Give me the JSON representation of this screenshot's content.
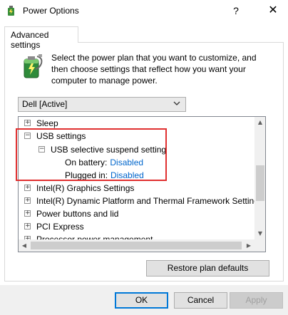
{
  "window": {
    "title": "Power Options",
    "help_glyph": "?",
    "close_glyph": "✕"
  },
  "tab": {
    "label": "Advanced settings"
  },
  "description": "Select the power plan that you want to customize, and then choose settings that reflect how you want your computer to manage power.",
  "plan_select": {
    "value": "Dell [Active]"
  },
  "tree": {
    "items": [
      {
        "label": "Sleep",
        "expander": "+"
      },
      {
        "label": "USB settings",
        "expander": "−"
      },
      {
        "label": "USB selective suspend setting",
        "expander": "−"
      },
      {
        "label": "On battery:",
        "value": "Disabled"
      },
      {
        "label": "Plugged in:",
        "value": "Disabled"
      },
      {
        "label": "Intel(R) Graphics Settings",
        "expander": "+"
      },
      {
        "label": "Intel(R) Dynamic Platform and Thermal Framework Setting",
        "expander": "+"
      },
      {
        "label": "Power buttons and lid",
        "expander": "+"
      },
      {
        "label": "PCI Express",
        "expander": "+"
      },
      {
        "label": "Processor power management",
        "expander": "+"
      }
    ]
  },
  "buttons": {
    "restore": "Restore plan defaults",
    "ok": "OK",
    "cancel": "Cancel",
    "apply": "Apply"
  },
  "colors": {
    "link_value": "#0066cc",
    "highlight_box": "#e03030",
    "ok_border": "#0078d7"
  }
}
